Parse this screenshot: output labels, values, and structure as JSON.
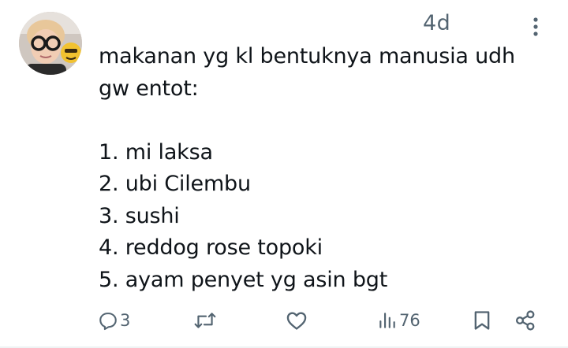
{
  "post": {
    "timestamp": "4d",
    "lines": [
      "makanan yg kl bentuknya manusia udh",
      "gw entot:",
      "1. mi laksa",
      "2. ubi Cilembu",
      "3. sushi",
      "4. reddog rose topoki",
      "5. ayam penyet yg asin bgt"
    ]
  },
  "actions": {
    "reply_count": "3",
    "views_count": "76"
  },
  "icons": {
    "reply": "reply-icon",
    "retweet": "retweet-icon",
    "like": "like-icon",
    "views": "views-icon",
    "bookmark": "bookmark-icon",
    "share": "share-icon",
    "more": "more-icon"
  },
  "colors": {
    "text": "#0f1419",
    "muted": "#536471"
  }
}
